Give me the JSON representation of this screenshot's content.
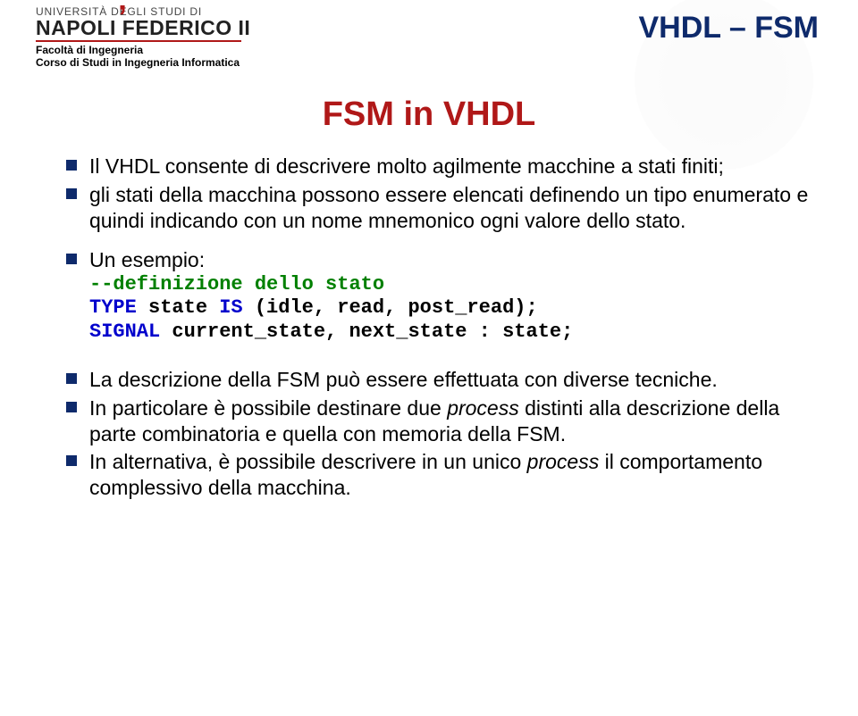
{
  "header": {
    "uni_top": "UNIVERSITÀ DEGLI STUDI DI",
    "uni_main": "NAPOLI FEDERICO II",
    "faculty": "Facoltà di Ingegneria",
    "course": "Corso di Studi in Ingegneria Informatica",
    "section_title": "VHDL – FSM"
  },
  "title": "FSM in VHDL",
  "intro": {
    "b1": "Il VHDL consente di descrivere molto agilmente macchine a stati finiti;",
    "b2": "gli stati della macchina possono essere elencati definendo un tipo enumerato e quindi indicando con un nome mnemonico ogni valore dello stato."
  },
  "example": {
    "label": "Un esempio:",
    "comment": "--definizione dello stato",
    "kw_type": "TYPE ",
    "txt_type": "state ",
    "kw_is": "IS ",
    "txt_enum": "(idle, read, post_read);",
    "kw_signal": "SIGNAL ",
    "txt_signal": "current_state, next_state : state;"
  },
  "closing": {
    "b1": "La descrizione della FSM può essere effettuata con diverse tecniche.",
    "b2a": "In particolare è possibile destinare due ",
    "b2_process": "process",
    "b2b": " distinti alla descrizione della parte combinatoria e quella con memoria della FSM.",
    "b3a": "In alternativa, è possibile descrivere in un unico ",
    "b3_process": "process",
    "b3b": " il comportamento complessivo della macchina."
  }
}
